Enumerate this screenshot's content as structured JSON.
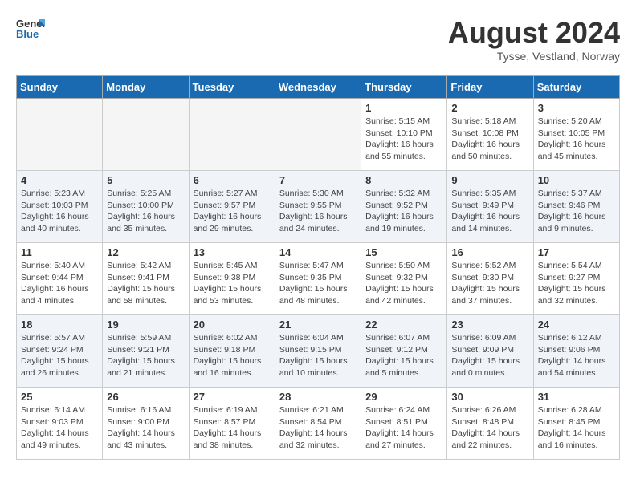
{
  "header": {
    "logo_line1": "General",
    "logo_line2": "Blue",
    "month_year": "August 2024",
    "location": "Tysse, Vestland, Norway"
  },
  "weekdays": [
    "Sunday",
    "Monday",
    "Tuesday",
    "Wednesday",
    "Thursday",
    "Friday",
    "Saturday"
  ],
  "weeks": [
    [
      {
        "day": "",
        "info": ""
      },
      {
        "day": "",
        "info": ""
      },
      {
        "day": "",
        "info": ""
      },
      {
        "day": "",
        "info": ""
      },
      {
        "day": "1",
        "info": "Sunrise: 5:15 AM\nSunset: 10:10 PM\nDaylight: 16 hours\nand 55 minutes."
      },
      {
        "day": "2",
        "info": "Sunrise: 5:18 AM\nSunset: 10:08 PM\nDaylight: 16 hours\nand 50 minutes."
      },
      {
        "day": "3",
        "info": "Sunrise: 5:20 AM\nSunset: 10:05 PM\nDaylight: 16 hours\nand 45 minutes."
      }
    ],
    [
      {
        "day": "4",
        "info": "Sunrise: 5:23 AM\nSunset: 10:03 PM\nDaylight: 16 hours\nand 40 minutes."
      },
      {
        "day": "5",
        "info": "Sunrise: 5:25 AM\nSunset: 10:00 PM\nDaylight: 16 hours\nand 35 minutes."
      },
      {
        "day": "6",
        "info": "Sunrise: 5:27 AM\nSunset: 9:57 PM\nDaylight: 16 hours\nand 29 minutes."
      },
      {
        "day": "7",
        "info": "Sunrise: 5:30 AM\nSunset: 9:55 PM\nDaylight: 16 hours\nand 24 minutes."
      },
      {
        "day": "8",
        "info": "Sunrise: 5:32 AM\nSunset: 9:52 PM\nDaylight: 16 hours\nand 19 minutes."
      },
      {
        "day": "9",
        "info": "Sunrise: 5:35 AM\nSunset: 9:49 PM\nDaylight: 16 hours\nand 14 minutes."
      },
      {
        "day": "10",
        "info": "Sunrise: 5:37 AM\nSunset: 9:46 PM\nDaylight: 16 hours\nand 9 minutes."
      }
    ],
    [
      {
        "day": "11",
        "info": "Sunrise: 5:40 AM\nSunset: 9:44 PM\nDaylight: 16 hours\nand 4 minutes."
      },
      {
        "day": "12",
        "info": "Sunrise: 5:42 AM\nSunset: 9:41 PM\nDaylight: 15 hours\nand 58 minutes."
      },
      {
        "day": "13",
        "info": "Sunrise: 5:45 AM\nSunset: 9:38 PM\nDaylight: 15 hours\nand 53 minutes."
      },
      {
        "day": "14",
        "info": "Sunrise: 5:47 AM\nSunset: 9:35 PM\nDaylight: 15 hours\nand 48 minutes."
      },
      {
        "day": "15",
        "info": "Sunrise: 5:50 AM\nSunset: 9:32 PM\nDaylight: 15 hours\nand 42 minutes."
      },
      {
        "day": "16",
        "info": "Sunrise: 5:52 AM\nSunset: 9:30 PM\nDaylight: 15 hours\nand 37 minutes."
      },
      {
        "day": "17",
        "info": "Sunrise: 5:54 AM\nSunset: 9:27 PM\nDaylight: 15 hours\nand 32 minutes."
      }
    ],
    [
      {
        "day": "18",
        "info": "Sunrise: 5:57 AM\nSunset: 9:24 PM\nDaylight: 15 hours\nand 26 minutes."
      },
      {
        "day": "19",
        "info": "Sunrise: 5:59 AM\nSunset: 9:21 PM\nDaylight: 15 hours\nand 21 minutes."
      },
      {
        "day": "20",
        "info": "Sunrise: 6:02 AM\nSunset: 9:18 PM\nDaylight: 15 hours\nand 16 minutes."
      },
      {
        "day": "21",
        "info": "Sunrise: 6:04 AM\nSunset: 9:15 PM\nDaylight: 15 hours\nand 10 minutes."
      },
      {
        "day": "22",
        "info": "Sunrise: 6:07 AM\nSunset: 9:12 PM\nDaylight: 15 hours\nand 5 minutes."
      },
      {
        "day": "23",
        "info": "Sunrise: 6:09 AM\nSunset: 9:09 PM\nDaylight: 15 hours\nand 0 minutes."
      },
      {
        "day": "24",
        "info": "Sunrise: 6:12 AM\nSunset: 9:06 PM\nDaylight: 14 hours\nand 54 minutes."
      }
    ],
    [
      {
        "day": "25",
        "info": "Sunrise: 6:14 AM\nSunset: 9:03 PM\nDaylight: 14 hours\nand 49 minutes."
      },
      {
        "day": "26",
        "info": "Sunrise: 6:16 AM\nSunset: 9:00 PM\nDaylight: 14 hours\nand 43 minutes."
      },
      {
        "day": "27",
        "info": "Sunrise: 6:19 AM\nSunset: 8:57 PM\nDaylight: 14 hours\nand 38 minutes."
      },
      {
        "day": "28",
        "info": "Sunrise: 6:21 AM\nSunset: 8:54 PM\nDaylight: 14 hours\nand 32 minutes."
      },
      {
        "day": "29",
        "info": "Sunrise: 6:24 AM\nSunset: 8:51 PM\nDaylight: 14 hours\nand 27 minutes."
      },
      {
        "day": "30",
        "info": "Sunrise: 6:26 AM\nSunset: 8:48 PM\nDaylight: 14 hours\nand 22 minutes."
      },
      {
        "day": "31",
        "info": "Sunrise: 6:28 AM\nSunset: 8:45 PM\nDaylight: 14 hours\nand 16 minutes."
      }
    ]
  ]
}
